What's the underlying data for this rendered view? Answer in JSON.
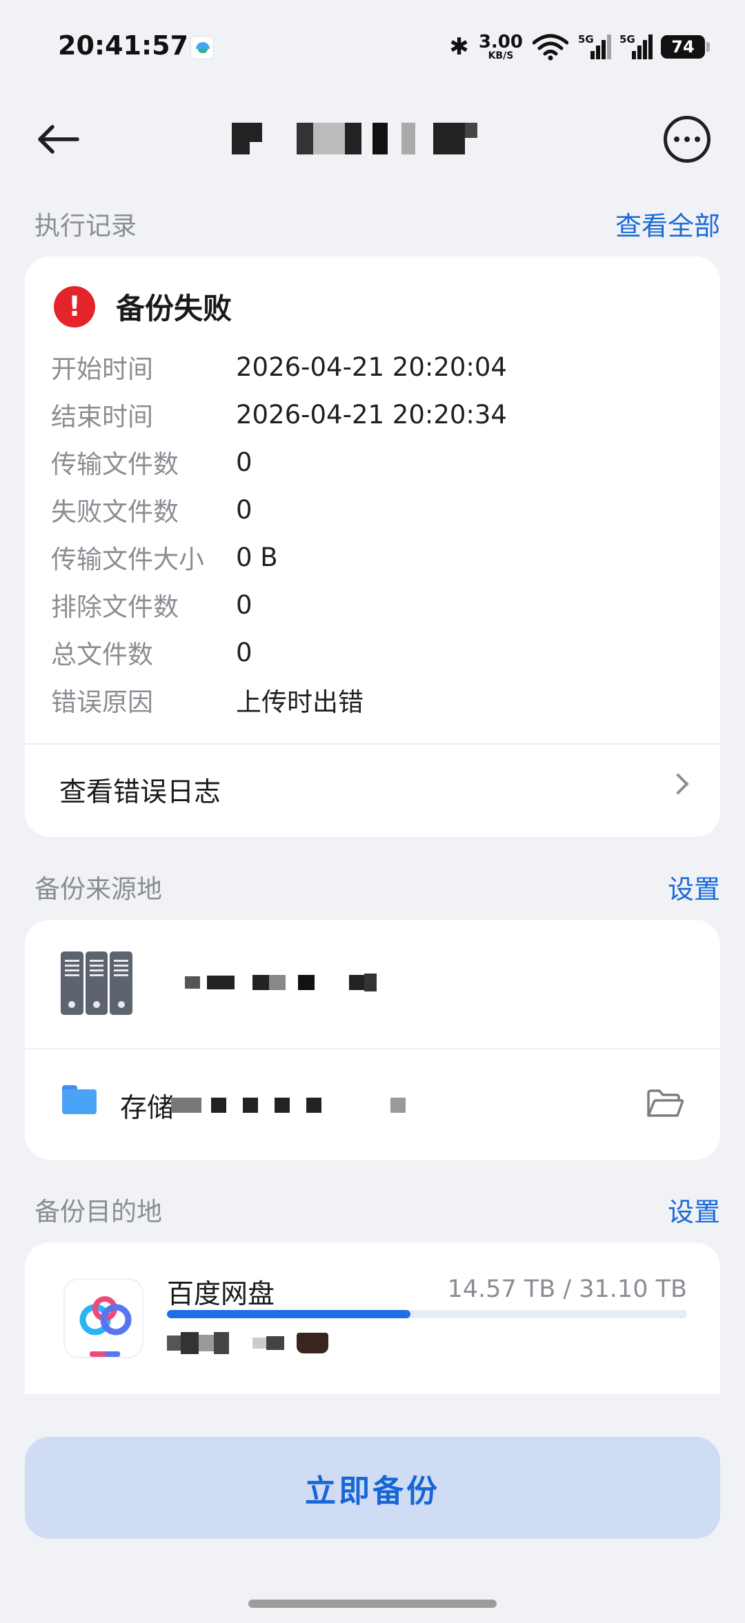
{
  "status_bar": {
    "time": "20:41:57",
    "net_speed_value": "3.00",
    "net_speed_unit": "KB/S",
    "signal1_label": "5G",
    "signal2_label": "5G",
    "battery": "74"
  },
  "execution": {
    "section_title": "执行记录",
    "view_all": "查看全部",
    "status": "备份失败",
    "fields": [
      {
        "label": "开始时间",
        "value": "2026-04-21 20:20:04"
      },
      {
        "label": "结束时间",
        "value": "2026-04-21 20:20:34"
      },
      {
        "label": "传输文件数",
        "value": "0"
      },
      {
        "label": "失败文件数",
        "value": "0"
      },
      {
        "label": "传输文件大小",
        "value": "0 B"
      },
      {
        "label": "排除文件数",
        "value": "0"
      },
      {
        "label": "总文件数",
        "value": "0"
      },
      {
        "label": "错误原因",
        "value": "上传时出错"
      }
    ],
    "error_log": "查看错误日志"
  },
  "source": {
    "section_title": "备份来源地",
    "settings": "设置",
    "storage_prefix": "存储"
  },
  "destination": {
    "section_title": "备份目的地",
    "settings": "设置",
    "service_name": "百度网盘",
    "quota_text": "14.57 TB / 31.10 TB",
    "usage_fraction": 0.4685
  },
  "actions": {
    "backup_now": "立即备份"
  },
  "colors": {
    "accent": "#1a6ad9",
    "error": "#e5232b"
  }
}
